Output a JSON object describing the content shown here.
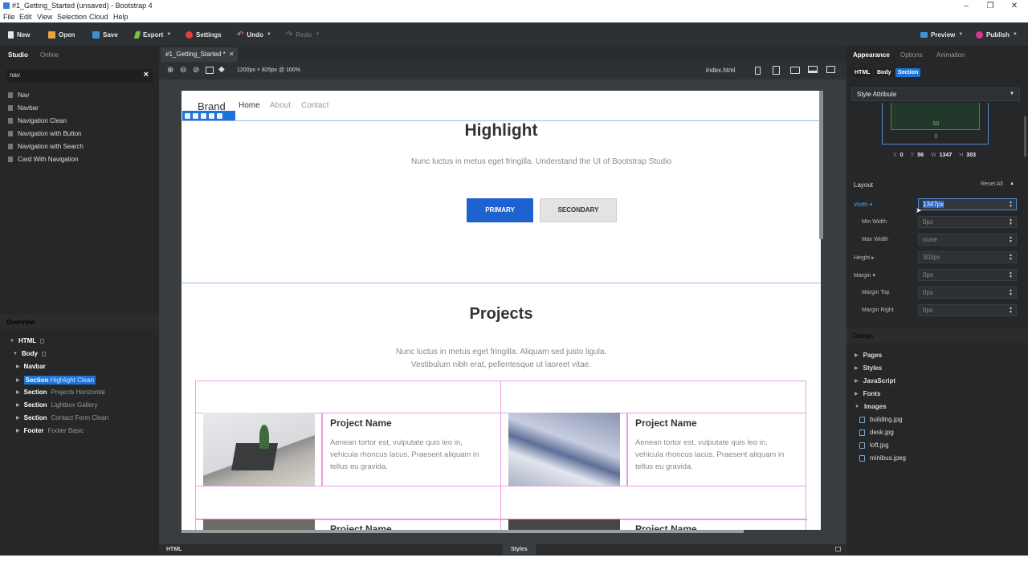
{
  "window": {
    "title": "#1_Getting_Started (unsaved) - Bootstrap 4",
    "minimize": "–",
    "maximize": "❐",
    "close": "✕"
  },
  "menu": [
    "File",
    "Edit",
    "View",
    "Selection",
    "Cloud",
    "Help"
  ],
  "toolbar": {
    "new": "New",
    "open": "Open",
    "save": "Save",
    "export": "Export",
    "settings": "Settings",
    "undo": "Undo",
    "redo": "Redo",
    "preview": "Preview",
    "publish": "Publish"
  },
  "left": {
    "tabs": [
      "Studio",
      "Online"
    ],
    "search_value": "nav",
    "clear": "×",
    "components": [
      "Nav",
      "Navbar",
      "Navigation Clean",
      "Navigation with Button",
      "Navigation with Search",
      "Card With Navigation"
    ],
    "overview_title": "Overview",
    "tree": {
      "html": "HTML",
      "body": "Body",
      "navbar": "Navbar",
      "sections": [
        {
          "tag": "Section",
          "name": "Highlight Clean"
        },
        {
          "tag": "Section",
          "name": "Projects Horizontal"
        },
        {
          "tag": "Section",
          "name": "Lightbox Gallery"
        },
        {
          "tag": "Section",
          "name": "Contact Form Clean"
        }
      ],
      "footer": {
        "tag": "Footer",
        "name": "Footer Basic"
      }
    }
  },
  "center": {
    "file_tab": "#1_Getting_Started *",
    "file_tab_close": "×",
    "viewport": "1200px × 825px @ 100%",
    "page_select": "index.html",
    "bottom_html": "HTML",
    "bottom_styles": "Styles"
  },
  "canvas": {
    "brand": "Brand",
    "nav_links": [
      "Home",
      "About",
      "Contact"
    ],
    "highlight_title": "Highlight",
    "highlight_text": "Nunc luctus in metus eget fringilla. Understand the UI of Bootstrap Studio",
    "primary": "PRIMARY",
    "secondary": "SECONDARY",
    "projects_title": "Projects",
    "projects_text": "Nunc luctus in metus eget fringilla. Aliquam sed justo ligula. Vestibulum nibh erat, pellentesque ut laoreet vitae.",
    "projects": [
      {
        "name": "Project Name",
        "desc": "Aenean tortor est, vulputate quis leo in, vehicula rhoncus lacus. Praesent aliquam in tellus eu gravida."
      },
      {
        "name": "Project Name",
        "desc": "Aenean tortor est, vulputate quis leo in, vehicula rhoncus lacus. Praesent aliquam in tellus eu gravida."
      },
      {
        "name": "Project Name"
      },
      {
        "name": "Project Name"
      }
    ]
  },
  "right": {
    "tabs": [
      "Appearance",
      "Options",
      "Animation"
    ],
    "chips": [
      "HTML",
      "Body",
      "Section"
    ],
    "style_dropdown": "Style Attribute",
    "box_value": "50",
    "box_bottom": "0",
    "coords": {
      "x_label": "X",
      "x": "0",
      "y_label": "Y",
      "y": "56",
      "w_label": "W",
      "w": "1347",
      "h_label": "H",
      "h": "303"
    },
    "layout_title": "Layout",
    "reset_all": "Reset All",
    "props": [
      {
        "label": "Width",
        "value": "1347px"
      },
      {
        "label": "Min Width",
        "value": "0px"
      },
      {
        "label": "Max Width",
        "value": "none"
      },
      {
        "label": "Height",
        "value": "303px"
      },
      {
        "label": "Margin",
        "value": "0px"
      },
      {
        "label": "Margin Top",
        "value": "0px"
      },
      {
        "label": "Margin Right",
        "value": "0px"
      }
    ],
    "design_title": "Design",
    "design_items": [
      "Pages",
      "Styles",
      "JavaScript",
      "Fonts",
      "Images"
    ],
    "images": [
      "building.jpg",
      "desk.jpg",
      "loft.jpg",
      "minibus.jpeg"
    ]
  },
  "colors": {
    "accent": "#1e73d6",
    "primary_button": "#1e62d0",
    "panel": "#252729",
    "toolbar": "#2e3133"
  }
}
